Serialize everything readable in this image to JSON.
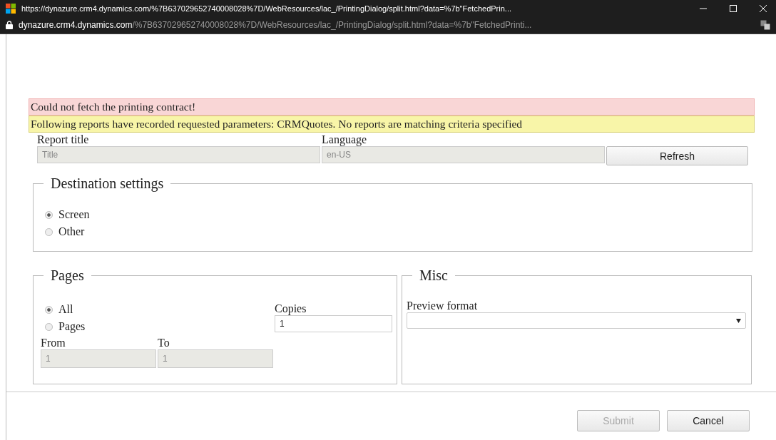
{
  "window": {
    "title": "https://dynazure.crm4.dynamics.com/%7B637029652740008028%7D/WebResources/lac_/PrintingDialog/split.html?data=%7b\"FetchedPrin...",
    "address_host": "dynazure.crm4.dynamics.com",
    "address_path": "/%7B637029652740008028%7D/WebResources/lac_/PrintingDialog/split.html?data=%7b\"FetchedPrinti..."
  },
  "messages": [
    {
      "kind": "error",
      "text": "Could not fetch the printing contract!"
    },
    {
      "kind": "warning",
      "text": "Following reports have recorded requested parameters: CRMQuotes. No reports are matching criteria specified"
    }
  ],
  "report_title": {
    "label": "Report title",
    "value": "Title",
    "disabled": true
  },
  "language": {
    "label": "Language",
    "value": "en-US",
    "disabled": true
  },
  "refresh_button": {
    "label": "Refresh"
  },
  "destination": {
    "legend": "Destination settings",
    "options": [
      {
        "label": "Screen",
        "selected": true
      },
      {
        "label": "Other",
        "selected": false
      }
    ]
  },
  "pages": {
    "legend": "Pages",
    "options": [
      {
        "label": "All",
        "selected": true
      },
      {
        "label": "Pages",
        "selected": false
      }
    ],
    "copies": {
      "label": "Copies",
      "value": "1",
      "disabled": false
    },
    "from": {
      "label": "From",
      "value": "1",
      "disabled": true
    },
    "to": {
      "label": "To",
      "value": "1",
      "disabled": true
    }
  },
  "misc": {
    "legend": "Misc",
    "preview_format": {
      "label": "Preview format"
    }
  },
  "buttons": [
    {
      "label": "Submit",
      "disabled": true
    },
    {
      "label": "Cancel",
      "disabled": false
    }
  ]
}
